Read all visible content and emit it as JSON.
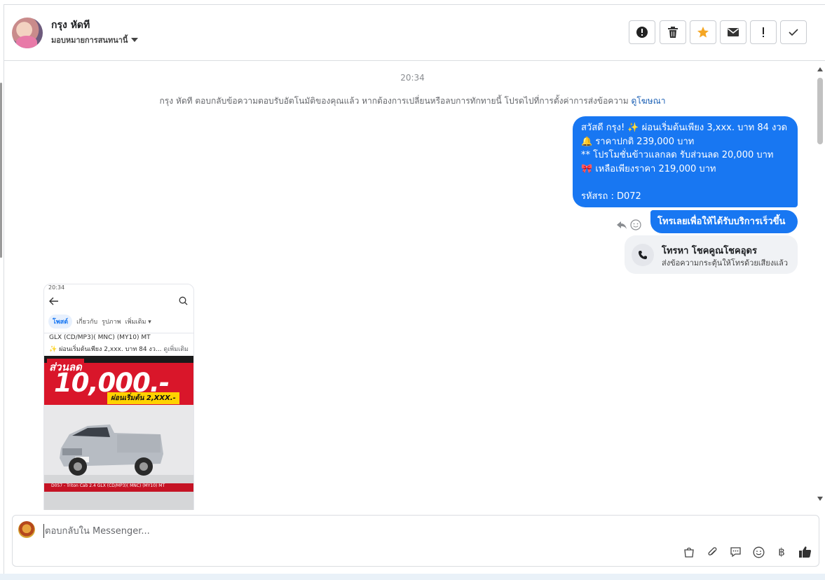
{
  "contact": {
    "name": "กรุง หัดที",
    "assign_label": "มอบหมายการสนทนานี้"
  },
  "toolbar": {
    "icons": [
      "exclamation-circle-icon",
      "trash-icon",
      "star-icon",
      "envelope-icon",
      "exclamation-icon",
      "check-icon"
    ],
    "star_color": "#f5a623"
  },
  "conversation": {
    "timestamp": "20:34",
    "notice_text": "กรุง หัดที ตอบกลับข้อความตอบรับอัตโนมัติของคุณแล้ว หากต้องการเปลี่ยนหรือลบการทักทายนี้ โปรดไปที่การตั้งค่าการส่งข้อความ",
    "notice_link": "ดูโฆษณา",
    "message1": {
      "line1": "สวัสดี กรุง! ✨  ผ่อนเริ่มต้นเพียง 3,xxx. บาท 84 งวด",
      "line2": "🔔 ราคาปกติ 239,000 บาท",
      "line3": "** โปรโมชั่นข้าวแลกลด รับส่วนลด 20,000 บาท",
      "line4": "🎀  เหลือเพียงราคา 219,000 บาท",
      "line5": "",
      "line6": "รหัสรถ : D072"
    },
    "message2": "โทรเลยเพื่อให้ได้รับบริการเร็วขึ้น",
    "call_card": {
      "title": "โทรหา โชคคูณโชคอุดร",
      "subtitle": "ส่งข้อความกระตุ้นให้โทรด้วยเสียงแล้ว"
    },
    "attachment": {
      "status_time": "20:34",
      "tabs": [
        "โพสต์",
        "เกี่ยวกับ",
        "รูปภาพ",
        "เพิ่มเติม ▾"
      ],
      "desc_line1": "GLX (CD/MP3)( MNC) (MY10) MT",
      "desc_line2": "✨ ผ่อนเริ่มต้นเพียง 2,xxx. บาท 84 งว...",
      "desc_more": "ดูเพิ่มเติม",
      "promo_tag": "ส่วนลด",
      "promo_big": "10,000.-",
      "promo_sub": "ผ่อนเริ่มต้น 2,XXX.-",
      "promo_bottom": "D057 - Triton Cab 2.4 GLX (CD/MP3)( MNC) (MY10) MT"
    }
  },
  "composer": {
    "placeholder": "ตอบกลับใน Messenger...",
    "tools": [
      "shopping-bag-icon",
      "paperclip-icon",
      "saved-reply-icon",
      "emoji-icon",
      "baht-icon",
      "thumbs-up-icon"
    ],
    "baht_symbol": "฿"
  }
}
